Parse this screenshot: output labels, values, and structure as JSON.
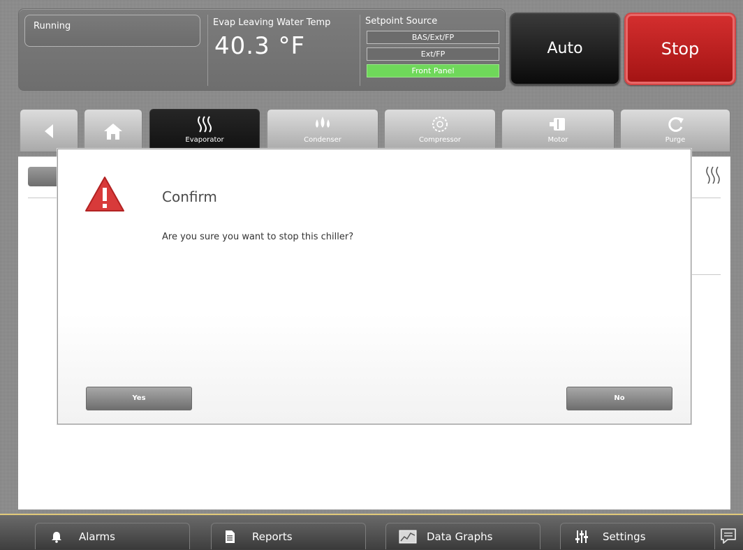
{
  "status": {
    "state": "Running",
    "temp_label": "Evap Leaving Water Temp",
    "temp_value": "40.3 °F",
    "setpoint_label": "Setpoint Source",
    "setpoint_options": [
      "BAS/Ext/FP",
      "Ext/FP",
      "Front Panel"
    ],
    "setpoint_selected": "Front Panel"
  },
  "controls": {
    "auto_label": "Auto",
    "stop_label": "Stop"
  },
  "tabs": [
    {
      "label": "",
      "icon": "back-arrow-icon"
    },
    {
      "label": "",
      "icon": "home-icon"
    },
    {
      "label": "Evaporator",
      "icon": "evaporator-icon",
      "selected": true
    },
    {
      "label": "Condenser",
      "icon": "condenser-icon"
    },
    {
      "label": "Compressor",
      "icon": "compressor-icon"
    },
    {
      "label": "Motor",
      "icon": "motor-icon"
    },
    {
      "label": "Purge",
      "icon": "purge-icon"
    }
  ],
  "dialog": {
    "title": "Confirm",
    "message": "Are you sure you want to stop this chiller?",
    "yes_label": "Yes",
    "no_label": "No"
  },
  "bottom_nav": [
    {
      "label": "Alarms",
      "icon": "bell-icon"
    },
    {
      "label": "Reports",
      "icon": "document-icon"
    },
    {
      "label": "Data Graphs",
      "icon": "chart-icon"
    },
    {
      "label": "Settings",
      "icon": "sliders-icon"
    }
  ],
  "colors": {
    "stop_red": "#c02020",
    "active_green": "#6fd85a",
    "warning_red": "#d83a3a"
  }
}
